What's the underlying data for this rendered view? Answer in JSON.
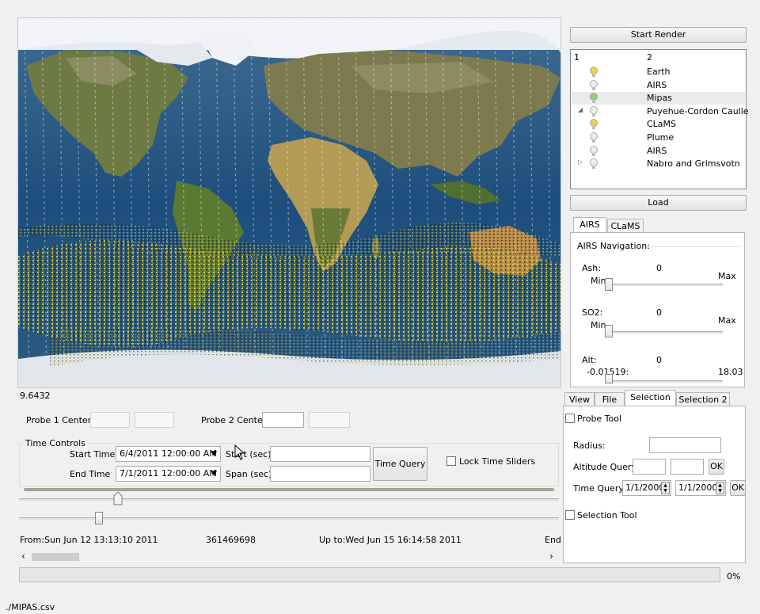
{
  "viewport": {
    "scale_value": "9.6432"
  },
  "right_panel": {
    "start_render": "Start Render",
    "tree": {
      "col1": "1",
      "col2": "2",
      "items": [
        {
          "label": "Earth",
          "bulb": "on"
        },
        {
          "label": "AIRS",
          "bulb": "off"
        },
        {
          "label": "Mipas",
          "bulb": "green"
        },
        {
          "label": "Puyehue-Cordon Caulle",
          "bulb": "off",
          "expander": "◢"
        },
        {
          "label": "CLaMS",
          "bulb": "on"
        },
        {
          "label": "Plume",
          "bulb": "off"
        },
        {
          "label": "AIRS",
          "bulb": "off"
        },
        {
          "label": "Nabro and Grimsvotn",
          "bulb": "off",
          "expander": "▷"
        }
      ]
    },
    "load": "Load",
    "airs_tabs": [
      "AIRS",
      "CLaMS"
    ],
    "airs_nav": {
      "title": "AIRS Navigation:",
      "ash_label": "Ash:",
      "ash_value": "0",
      "ash_min": "Min",
      "ash_max": "Max",
      "so2_label": "SO2:",
      "so2_value": "0",
      "so2_min": "Min",
      "so2_max": "Max",
      "alt_label": "Alt:",
      "alt_value": "0",
      "alt_min": "-0.01519:",
      "alt_max": "18.03"
    },
    "bottom_tabs": [
      "View",
      "File",
      "Selection",
      "Selection 2"
    ],
    "selection": {
      "probe_tool": "Probe Tool",
      "radius": "Radius:",
      "altitude_query": "Altitude Query:",
      "ok": "OK",
      "time_query": "Time Query:",
      "date1": "1/1/2000",
      "date2": "1/1/2000",
      "selection_tool": "Selection Tool"
    }
  },
  "probes": {
    "probe1": "Probe 1 Center:",
    "probe2": "Probe 2 Center:"
  },
  "time_controls": {
    "title": "Time Controls",
    "start_label": "Start Time:",
    "start_value": "6/4/2011 12:00:00 AM",
    "end_label": "End Time",
    "end_value": "7/1/2011 12:00:00 AM",
    "start_sec": "Start (sec):",
    "span_sec": "Span (sec):",
    "time_query": "Time Query",
    "lock": "Lock Time  Sliders"
  },
  "timeline": {
    "from": "From:Sun Jun 12 13:13:10 2011",
    "middle": "361469698",
    "upto": "Up to:Wed Jun 15 16:14:58 2011",
    "end": "End"
  },
  "progress": {
    "value": 0,
    "label": "0%"
  },
  "status": {
    "file": "./MIPAS.csv"
  },
  "colors": {
    "ocean": "#2a5a86",
    "land": "#6b7a3a",
    "plume": "#c8c040"
  }
}
